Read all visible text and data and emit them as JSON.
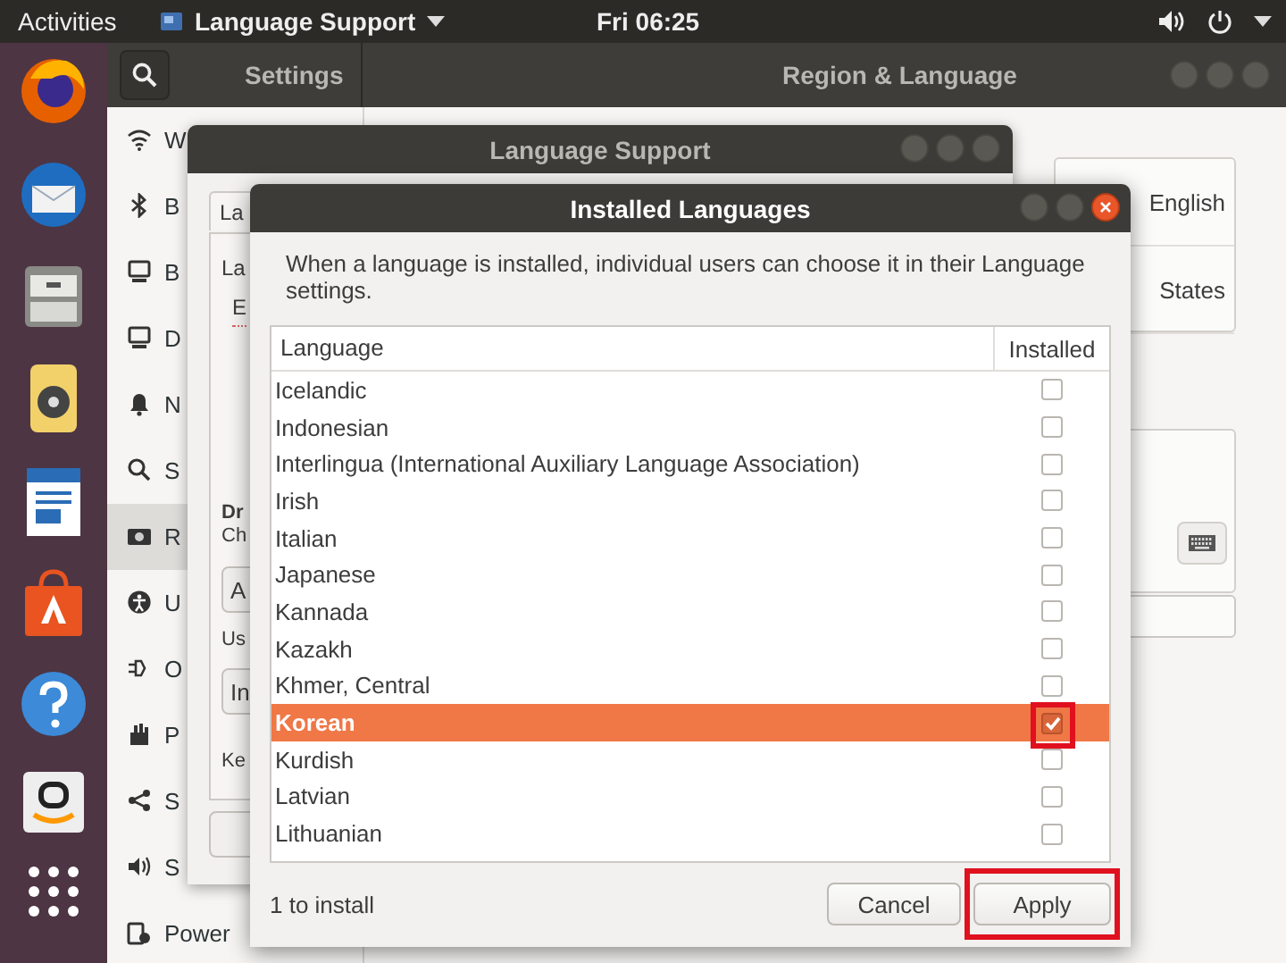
{
  "top_bar": {
    "activities": "Activities",
    "app_menu": "Language Support",
    "clock": "Fri 06:25"
  },
  "settings": {
    "title": "Settings",
    "panel_title": "Region & Language",
    "focused": false,
    "sidebar": [
      {
        "label": "W",
        "selected": false
      },
      {
        "label": "B",
        "selected": false
      },
      {
        "label": "B",
        "selected": false
      },
      {
        "label": "D",
        "selected": false
      },
      {
        "label": "N",
        "selected": false
      },
      {
        "label": "S",
        "selected": false
      },
      {
        "label": "R",
        "selected": true
      },
      {
        "label": "U",
        "selected": false
      },
      {
        "label": "O",
        "selected": false
      },
      {
        "label": "P",
        "selected": false
      },
      {
        "label": "S",
        "selected": false
      },
      {
        "label": "S",
        "selected": false
      },
      {
        "label": "Power",
        "selected": false
      }
    ],
    "language_value": "English",
    "formats_value": "States"
  },
  "language_support": {
    "title": "Language Support",
    "focused": false,
    "tab": "La",
    "section_label": "La",
    "language_item": "E",
    "drag_title": "Dr",
    "drag_hint": "Ch",
    "apply_button": "A",
    "use_label": "Us",
    "input_field": "In",
    "keyboard_label": "Ke"
  },
  "installed_languages": {
    "title": "Installed Languages",
    "focused": true,
    "description": "When a language is installed, individual users can choose it in their Language settings.",
    "columns": [
      "Language",
      "Installed"
    ],
    "rows": [
      {
        "name": "Icelandic",
        "installed": false,
        "selected": false
      },
      {
        "name": "Indonesian",
        "installed": false,
        "selected": false
      },
      {
        "name": "Interlingua (International Auxiliary Language Association)",
        "installed": false,
        "selected": false
      },
      {
        "name": "Irish",
        "installed": false,
        "selected": false
      },
      {
        "name": "Italian",
        "installed": false,
        "selected": false
      },
      {
        "name": "Japanese",
        "installed": false,
        "selected": false
      },
      {
        "name": "Kannada",
        "installed": false,
        "selected": false
      },
      {
        "name": "Kazakh",
        "installed": false,
        "selected": false
      },
      {
        "name": "Khmer, Central",
        "installed": false,
        "selected": false
      },
      {
        "name": "Korean",
        "installed": true,
        "selected": true
      },
      {
        "name": "Kurdish",
        "installed": false,
        "selected": false
      },
      {
        "name": "Latvian",
        "installed": false,
        "selected": false
      },
      {
        "name": "Lithuanian",
        "installed": false,
        "selected": false
      }
    ],
    "status": "1 to install",
    "buttons": [
      "Cancel",
      "Apply"
    ]
  }
}
